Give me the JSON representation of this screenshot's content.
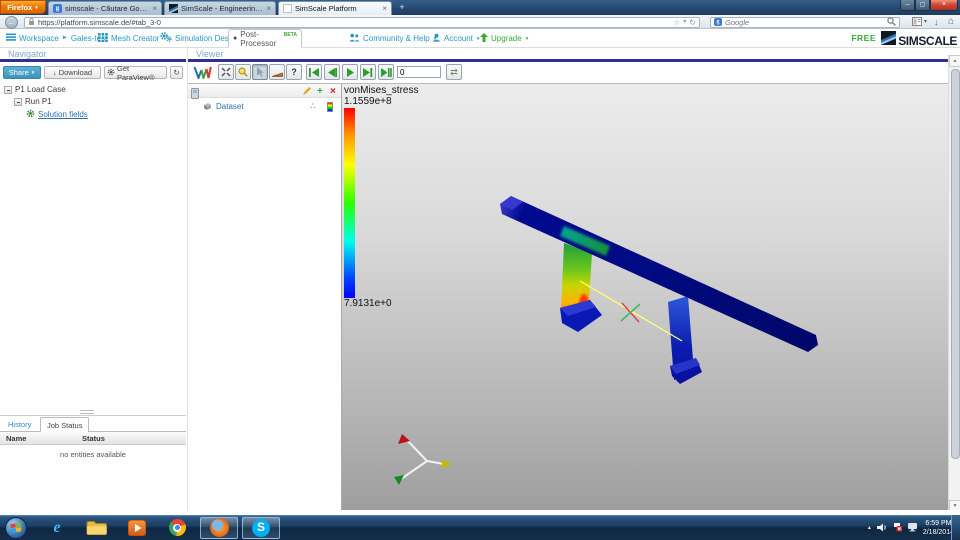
{
  "browser": {
    "firefox_button": "Firefox",
    "tabs": [
      {
        "title": "simscale - Căutare Google"
      },
      {
        "title": "SimScale - Engineering simulation in ..."
      },
      {
        "title": "SimScale Platform"
      }
    ],
    "url": "https://platform.simscale.de/#tab_3-0",
    "search_placeholder": "Google"
  },
  "app_nav": {
    "workspace": "Workspace",
    "project": "Gales-test",
    "mesh_creator": "Mesh Creator",
    "simulation_designer": "Simulation Designer",
    "post_processor": "Post-Processor",
    "beta": "BETA",
    "community": "Community & Help",
    "account": "Account",
    "upgrade": "Upgrade",
    "plan": "FREE",
    "brand": "SIMSCALE"
  },
  "navigator": {
    "title": "Navigator",
    "share": "Share",
    "download": "Download",
    "get_paraview": "Get ParaView®",
    "tree": [
      {
        "label": "P1 Load Case"
      },
      {
        "label": "Run P1"
      },
      {
        "label": "Solution fields"
      }
    ]
  },
  "viewer": {
    "title": "Viewer",
    "frame_value": "0",
    "pipeline": {
      "dataset": "Dataset"
    },
    "legend": {
      "title": "vonMises_stress",
      "max": "1.1559e+8",
      "min": "7.9131e+0"
    }
  },
  "bottom_panel": {
    "tabs": [
      {
        "label": "History"
      },
      {
        "label": "Job Status"
      }
    ],
    "columns": [
      {
        "label": "Name"
      },
      {
        "label": "Status"
      }
    ],
    "empty": "no entities available"
  },
  "taskbar": {
    "time": "6:59 PM",
    "date": "2/18/2014"
  },
  "icons": {
    "caret_down": "▼",
    "dropdown": "▾",
    "breadcrumb": "►",
    "back_arrow": "←",
    "star": "☆",
    "reload": "↻",
    "home": "⌂",
    "close": "×",
    "new_tab": "+",
    "plus": "+",
    "dots": "∴",
    "help": "?",
    "down_arrow": "↓",
    "refresh": "↻",
    "loop": "⇄",
    "window_min": "─",
    "window_max": "▢",
    "window_close": "×",
    "tray_arrow": "▲",
    "post_dot": "●",
    "ie_e": "e",
    "skype_s": "S",
    "google_g": "g",
    "sb_up": "▲",
    "sb_down": "▼"
  },
  "colors": {
    "accent_teal": "#2a97be",
    "navy": "#2e3192",
    "green": "#3aaa35",
    "legend_stops": [
      "#ff0000",
      "#ffff00",
      "#00ff00",
      "#00ffff",
      "#0000ff"
    ]
  }
}
